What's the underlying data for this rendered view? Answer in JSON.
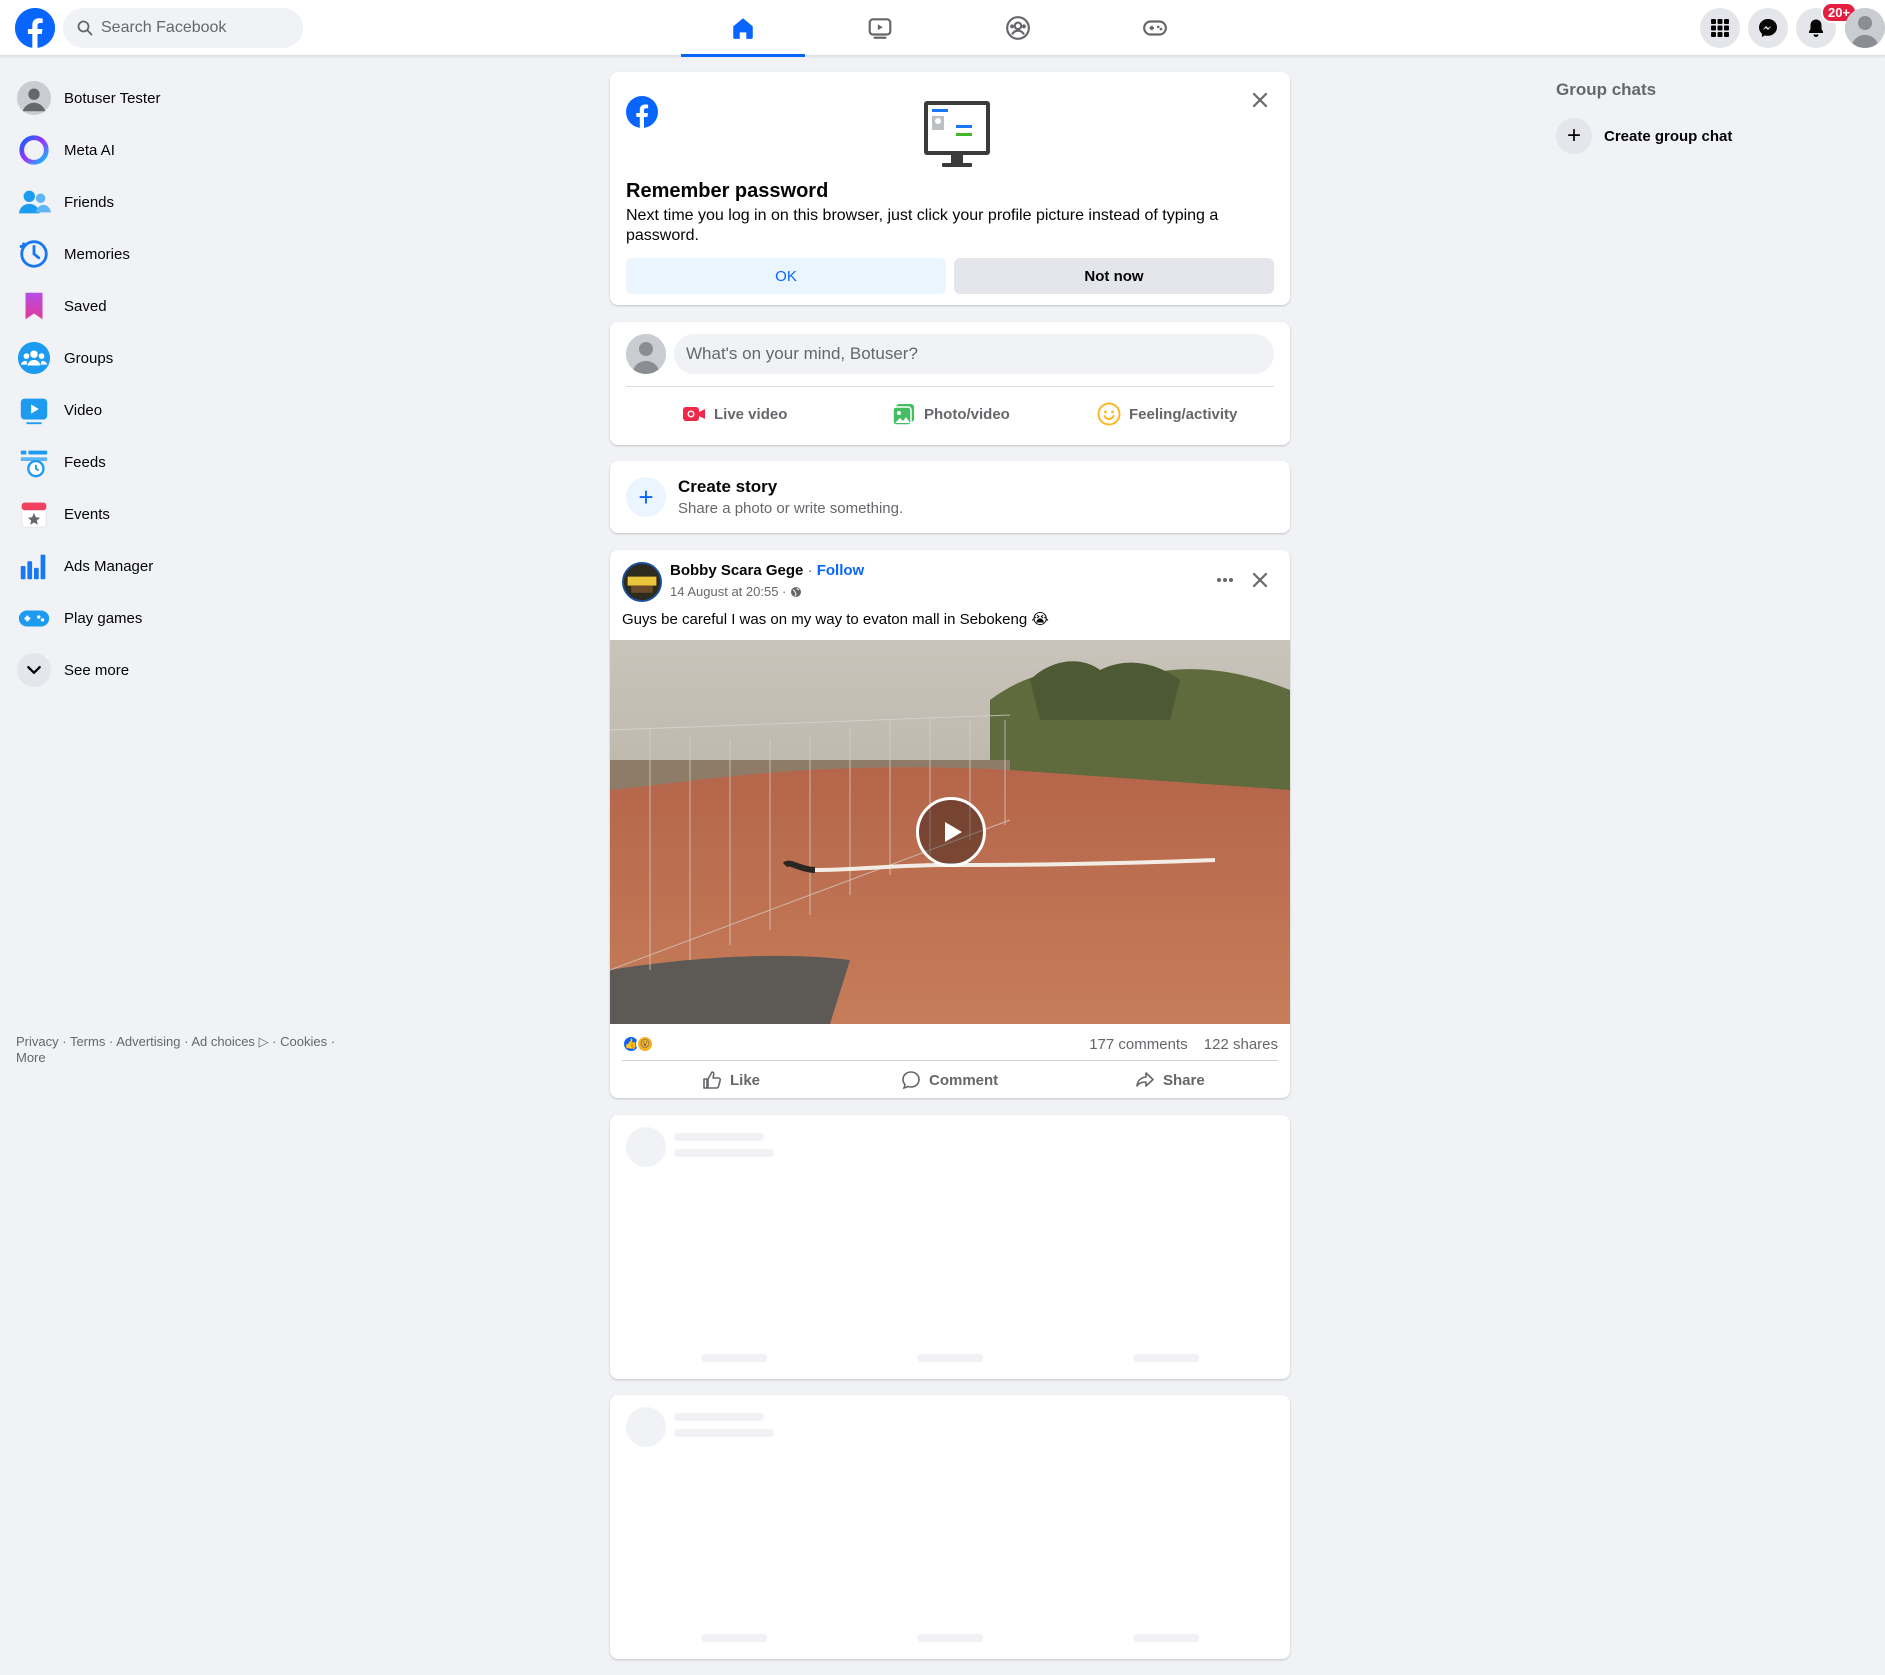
{
  "search": {
    "placeholder": "Search Facebook"
  },
  "topnav": {
    "tabs": [
      "Home",
      "Video",
      "Groups",
      "Gaming"
    ],
    "active_tab": "Home",
    "notification_badge": "20+"
  },
  "sidebar": {
    "items": [
      {
        "label": "Botuser Tester",
        "icon": "profile-avatar"
      },
      {
        "label": "Meta AI",
        "icon": "meta-ai-icon"
      },
      {
        "label": "Friends",
        "icon": "friends-icon"
      },
      {
        "label": "Memories",
        "icon": "memories-icon"
      },
      {
        "label": "Saved",
        "icon": "saved-icon"
      },
      {
        "label": "Groups",
        "icon": "groups-icon"
      },
      {
        "label": "Video",
        "icon": "video-icon"
      },
      {
        "label": "Feeds",
        "icon": "feeds-icon"
      },
      {
        "label": "Events",
        "icon": "events-icon"
      },
      {
        "label": "Ads Manager",
        "icon": "ads-manager-icon"
      },
      {
        "label": "Play games",
        "icon": "play-games-icon"
      },
      {
        "label": "See more",
        "icon": "chevron-down-icon"
      }
    ],
    "footer": {
      "privacy": "Privacy",
      "terms": "Terms",
      "advertising": "Advertising",
      "ad_choices": "Ad choices",
      "cookies": "Cookies",
      "more": "More"
    }
  },
  "remember_password": {
    "title": "Remember password",
    "text": "Next time you log in on this browser, just click your profile picture instead of typing a password.",
    "ok_label": "OK",
    "not_now_label": "Not now"
  },
  "composer": {
    "placeholder": "What's on your mind, Botuser?",
    "live_video": "Live video",
    "photo_video": "Photo/video",
    "feeling": "Feeling/activity"
  },
  "story": {
    "title": "Create story",
    "subtitle": "Share a photo or write something."
  },
  "post": {
    "author": "Bobby Scara Gege",
    "separator": "·",
    "follow": "Follow",
    "time": "14 August at 20:55 ·",
    "text": "Guys be careful I was on my way to evaton mall in Sebokeng 😭",
    "comments": "177 comments",
    "shares": "122 shares",
    "like_label": "Like",
    "comment_label": "Comment",
    "share_label": "Share"
  },
  "right": {
    "group_chats_title": "Group chats",
    "create_group_label": "Create group chat"
  },
  "colors": {
    "brand": "#0866ff",
    "background": "#f0f2f5",
    "badge": "#e41e3f"
  }
}
